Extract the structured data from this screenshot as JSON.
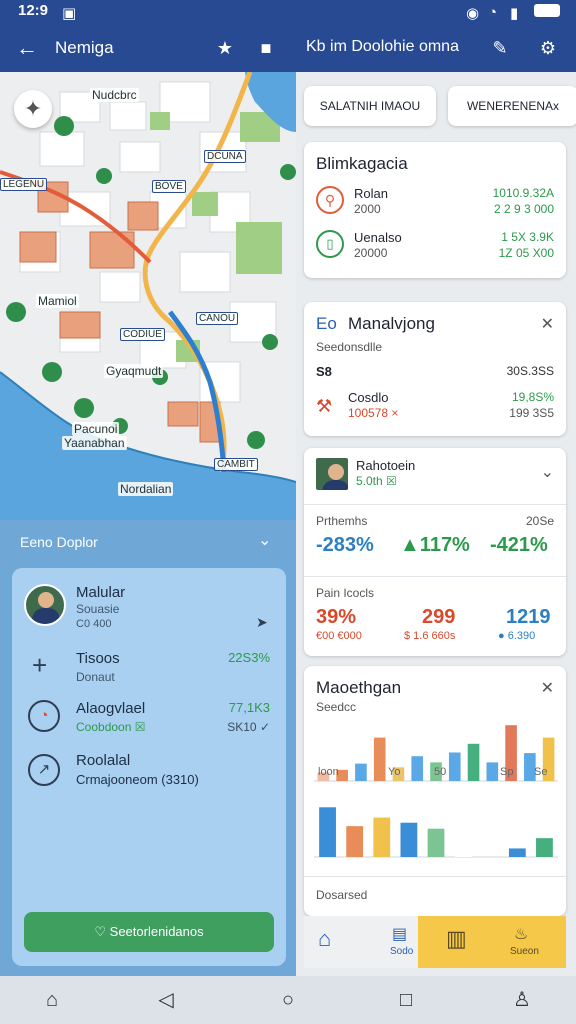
{
  "status": {
    "time": "12:9",
    "icons": [
      "save-icon",
      "signal-icon",
      "wifi-icon",
      "bars-icon",
      "battery-icon"
    ]
  },
  "appbar": {
    "left_title": "Nemiga",
    "right_title": "Kb im Doolohie omna"
  },
  "map": {
    "labels": [
      "Nudcbrc",
      "Mamiol",
      "Gyaqmudt",
      "Pacunoi",
      "Yaanabhan",
      "Nordalian"
    ],
    "chips": [
      "LEGENU",
      "DCUNA",
      "BOVE",
      "CODIUE",
      "CANOU",
      "CAMBIT"
    ]
  },
  "sheet": {
    "header": "Eeno Doplor",
    "person": {
      "name": "Malular",
      "role": "Souasie",
      "meta": "C0 400"
    },
    "rows": [
      {
        "title": "Tisoos",
        "sub": "Donaut",
        "value": "22S3%",
        "value_color": "#2c9a4c",
        "sub2": ""
      },
      {
        "title": "Alaogvlael",
        "sub": "Coobdoon ☒",
        "value": "77,1K3",
        "value_color": "#2c9a4c",
        "sub2": "SK10 ✓"
      },
      {
        "title": "Roolalal",
        "sub": "Crmajooneom (3310)",
        "value": "",
        "value_color": "#2c9a4c",
        "sub2": ""
      }
    ],
    "cta": "Seetorlenidanos"
  },
  "right": {
    "pills": [
      "SALATNIH IMAOU",
      "WENERENENAx"
    ],
    "card1": {
      "title": "Blimkagacia",
      "rows": [
        {
          "label": "Rolan",
          "sub": "2000",
          "val1": "1010.9.32A",
          "val2": "2 2 9 3 000",
          "icon_color": "#e35c3a"
        },
        {
          "label": "Uenalso",
          "sub": "20000",
          "val1": "1 5X 3.9K",
          "val2": "1Z 05 X00",
          "icon_color": "#2c9a4c"
        }
      ]
    },
    "card2": {
      "title_prefix": "Eo",
      "title": "Manalvjong",
      "subtitle": "Seedonsdlle",
      "rows": [
        {
          "label": "S8",
          "val": "30S.3SS",
          "val2": ""
        },
        {
          "label": "Cosdlo",
          "sub": "100578 ×",
          "val": "19,8S%",
          "val2": "199 3S5"
        }
      ]
    },
    "card3": {
      "name": "Rahotoein",
      "sub": "5.0th ☒",
      "stats_label": "Prthemhs",
      "stats_label_right": "20Se",
      "stats": [
        {
          "value": "-283%",
          "color": "#2b7fc2"
        },
        {
          "value": "▲117%",
          "color": "#2c9a4c"
        },
        {
          "value": "-421%",
          "color": "#2c9a4c"
        }
      ],
      "stats2_label": "Pain Icocls",
      "stats2": [
        {
          "value": "39%",
          "sub": "€00 €000",
          "color": "#d9492b"
        },
        {
          "value": "299",
          "sub": "$ 1.6 660s",
          "color": "#d9492b"
        },
        {
          "value": "1219",
          "sub": "● 6.390",
          "color": "#2b7fc2"
        }
      ]
    },
    "card4": {
      "title": "Maoethgan",
      "subtitle": "Seedcc",
      "x_labels": [
        "loon",
        "Yo",
        "50",
        "Sp",
        "Se"
      ],
      "footer": "Dosarsed"
    },
    "tabs": [
      {
        "label": "",
        "icon": "home-icon"
      },
      {
        "label": "Sodo",
        "icon": "calendar-icon"
      },
      {
        "label": "",
        "icon": "book-icon"
      },
      {
        "label": "Sueon",
        "icon": "chef-icon"
      }
    ]
  },
  "chart_data": [
    {
      "type": "bar",
      "categories": [
        "loon",
        "",
        "",
        "Yo",
        "",
        "",
        "50",
        "",
        "",
        "Sp",
        "",
        "",
        "Se"
      ],
      "series": [
        {
          "values": [
            14,
            18,
            28,
            70,
            22,
            40,
            30,
            46,
            60,
            30,
            90,
            45,
            70
          ]
        }
      ],
      "colors": [
        "#f2b9a3",
        "#e88d59",
        "#5aa9e6",
        "#e88d59",
        "#e9c46a",
        "#5aa9e6",
        "#7cc593",
        "#5aa9e6",
        "#45b07d",
        "#5aa9e6",
        "#e2795a",
        "#5aa9e6",
        "#f0c24b"
      ],
      "ylim": [
        0,
        100
      ]
    },
    {
      "type": "bar",
      "categories": [
        "",
        "",
        "",
        "",
        "",
        "",
        "",
        "",
        ""
      ],
      "series": [
        {
          "values": [
            58,
            36,
            46,
            40,
            33,
            28,
            0,
            10,
            22
          ]
        }
      ],
      "colors": [
        "#3a8ed8",
        "#e88d59",
        "#f0c24b",
        "#3a8ed8",
        "#7cc593",
        "#ffffff",
        "#ffffff",
        "#3a8ed8",
        "#45b07d"
      ],
      "ylim": [
        0,
        70
      ]
    }
  ]
}
